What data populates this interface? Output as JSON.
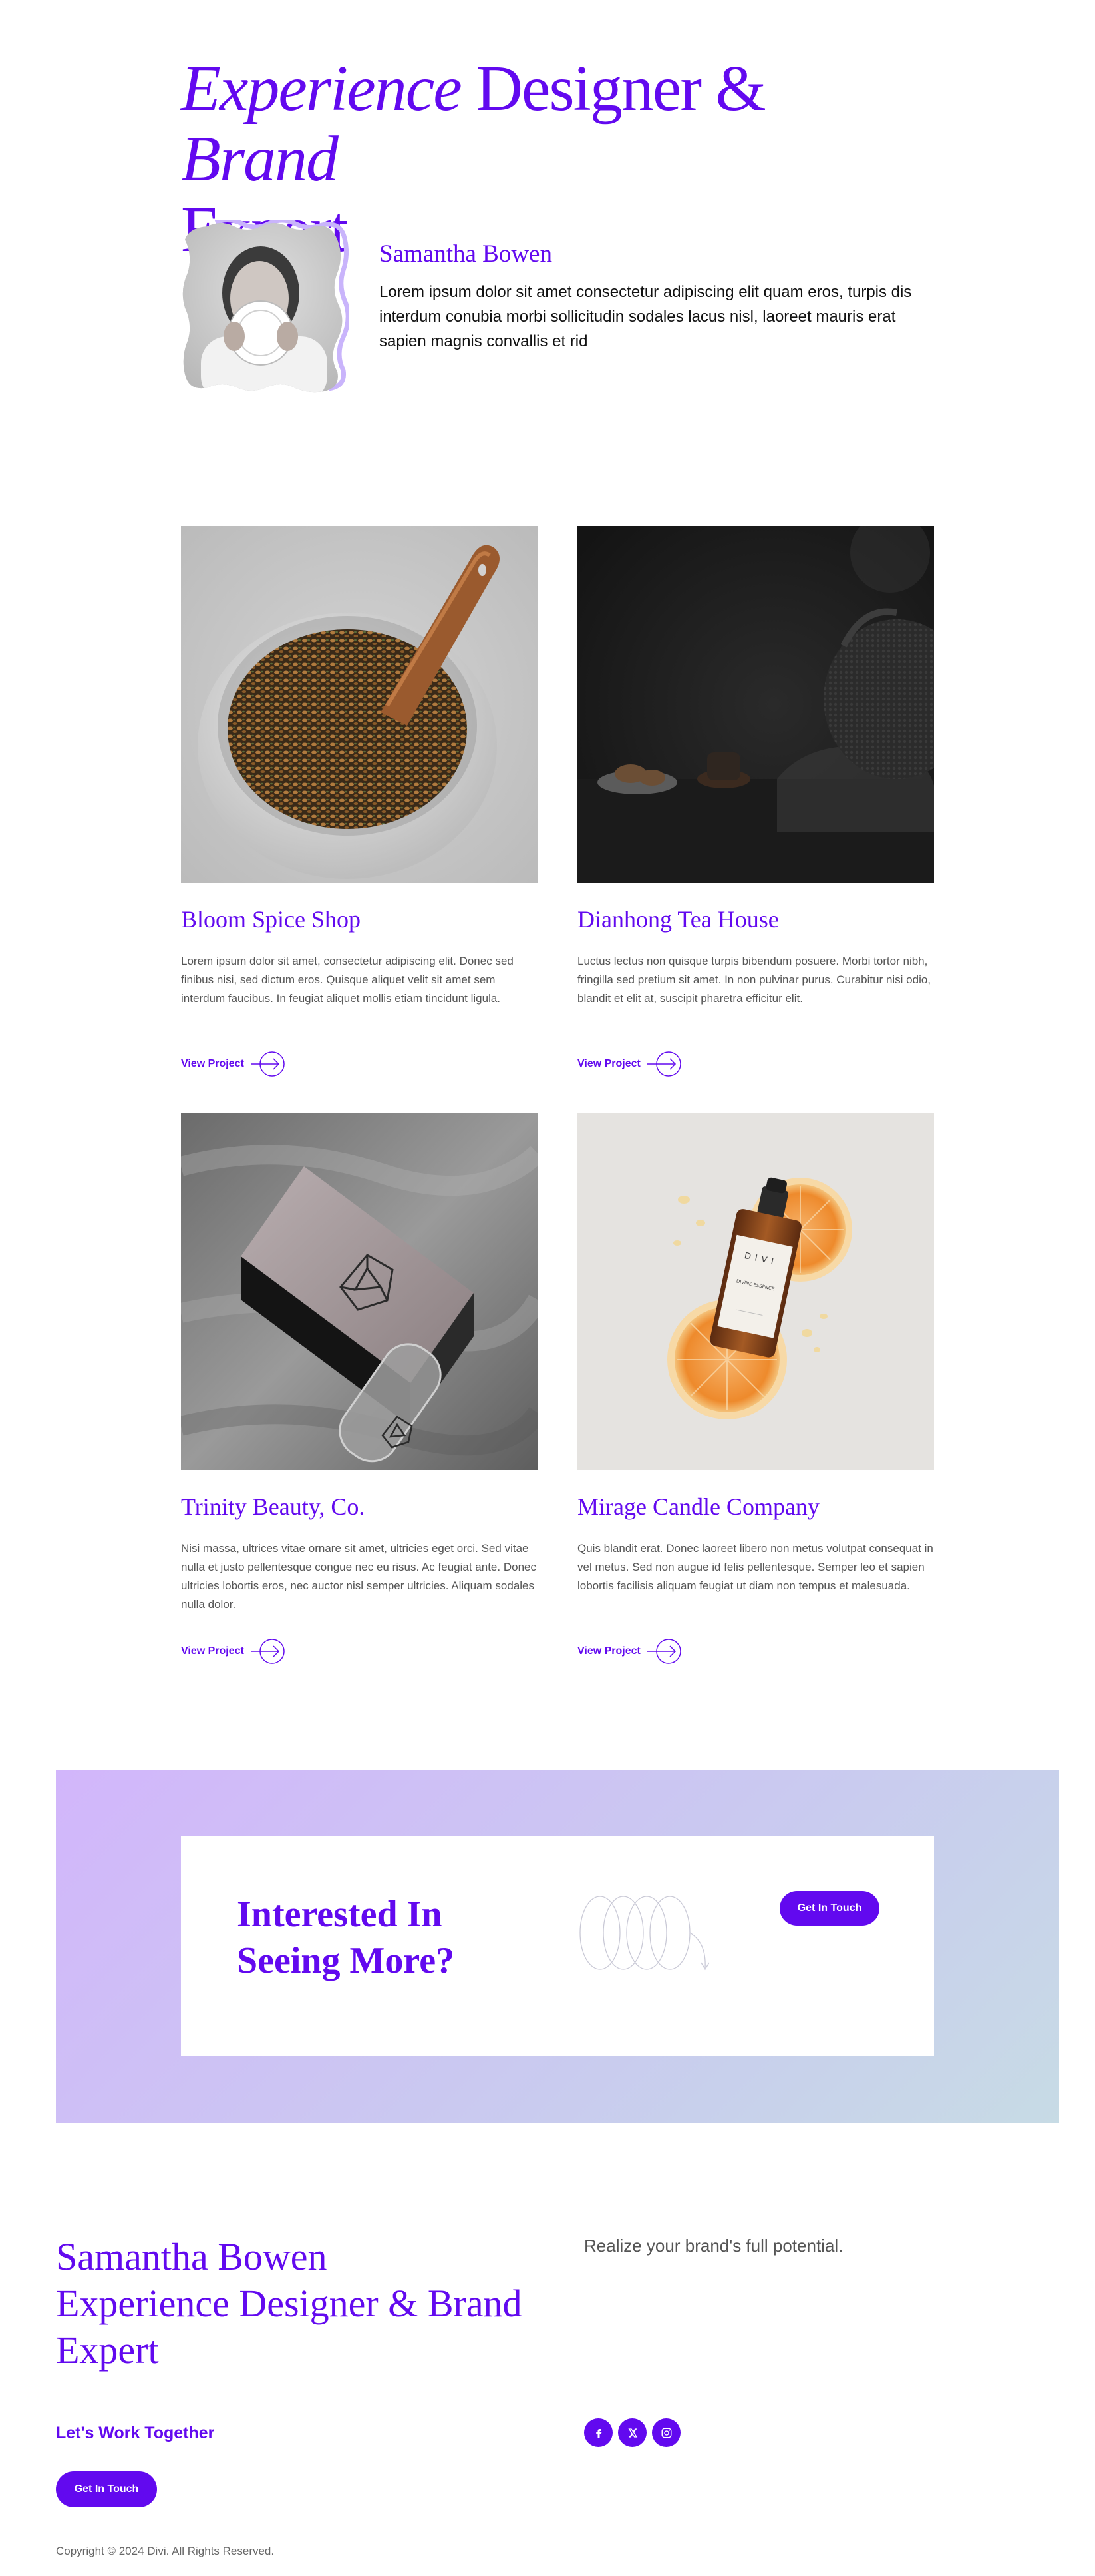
{
  "hero": {
    "title_part1": "Experience",
    "title_part2": " Designer & ",
    "title_part3": "Brand",
    "title_part4": "Expert"
  },
  "profile": {
    "name": "Samantha Bowen",
    "bio": "Lorem ipsum dolor sit amet consectetur adipiscing elit quam eros, turpis dis interdum conubia morbi sollicitudin sodales lacus nisl, laoreet mauris erat sapien magnis convallis et rid"
  },
  "projects": [
    {
      "title": "Bloom Spice Shop",
      "description": "Lorem ipsum dolor sit amet, consectetur adipiscing elit. Donec sed finibus nisi, sed dictum eros. Quisque aliquet velit sit amet sem interdum faucibus. In feugiat aliquet mollis etiam tincidunt ligula.",
      "link": "View Project"
    },
    {
      "title": "Dianhong Tea House",
      "description": "Luctus lectus non quisque turpis bibendum posuere. Morbi tortor nibh, fringilla sed pretium sit amet. In non pulvinar purus. Curabitur nisi odio, blandit et elit at, suscipit pharetra efficitur elit.",
      "link": "View Project"
    },
    {
      "title": "Trinity Beauty, Co.",
      "description": "Nisi massa, ultrices vitae ornare sit amet, ultricies eget orci. Sed vitae nulla et justo pellentesque congue nec eu risus. Ac feugiat ante. Donec ultricies lobortis eros, nec auctor nisl semper ultricies. Aliquam sodales nulla dolor.",
      "link": "View Project"
    },
    {
      "title": "Mirage Candle Company",
      "description": "Quis blandit erat. Donec laoreet libero non metus volutpat consequat in vel metus. Sed non augue id felis pellentesque. Semper leo et sapien lobortis facilisis aliquam feugiat ut diam non tempus et malesuada.",
      "link": "View Project"
    }
  ],
  "cta": {
    "title": "Interested In Seeing More?",
    "button": "Get In Touch"
  },
  "footer": {
    "name": "Samantha Bowen",
    "role": "Experience Designer & Brand Expert",
    "tagline": "Realize your brand's full potential.",
    "work_together": "Let's Work Together",
    "button": "Get In Touch",
    "socials": [
      "facebook-icon",
      "x-icon",
      "instagram-icon"
    ],
    "copyright": "Copyright © 2024 Divi. All Rights Reserved."
  },
  "product_label": {
    "brand": "DIVI",
    "name": "DIVINE ESSENCE"
  },
  "colors": {
    "accent": "#6209ef",
    "gradient_start": "#d2b6fb",
    "gradient_end": "#c7dbe5"
  }
}
